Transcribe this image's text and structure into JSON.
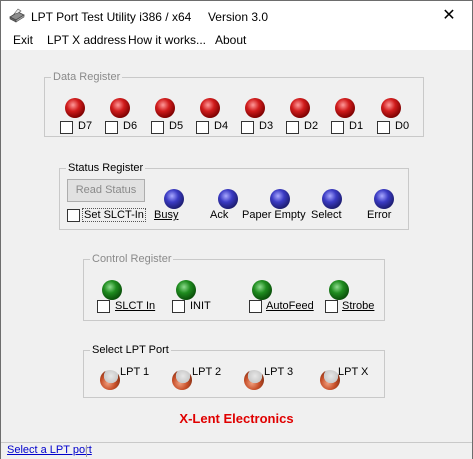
{
  "window": {
    "title": "LPT Port Test Utility i386 / x64     Version 3.0",
    "close_symbol": "✕"
  },
  "menu": [
    "Exit",
    "LPT X address",
    "How it works...",
    "About"
  ],
  "data_register": {
    "title": "Data Register",
    "bits": [
      "D7",
      "D6",
      "D5",
      "D4",
      "D3",
      "D2",
      "D1",
      "D0"
    ],
    "led_color": "#d11c1c"
  },
  "status_register": {
    "title": "Status Register",
    "read_button": "Read Status",
    "set_label": "Set SLCT-In",
    "signals": [
      "Busy",
      "Ack",
      "Paper Empty",
      "Select",
      "Error"
    ],
    "led_color": "#3b3bc4"
  },
  "control_register": {
    "title": "Control Register",
    "signals": [
      "SLCT In",
      "INIT",
      "AutoFeed",
      "Strobe"
    ],
    "led_color": "#1f8c1f"
  },
  "lpt_select": {
    "title": "Select LPT Port",
    "ports": [
      "LPT 1",
      "LPT 2",
      "LPT 3",
      "LPT X"
    ],
    "icon_color": "#c8502a"
  },
  "brand": {
    "text": "X-Lent Electronics",
    "color": "#e00000"
  },
  "status_bar": {
    "text": "Select a LPT port"
  }
}
